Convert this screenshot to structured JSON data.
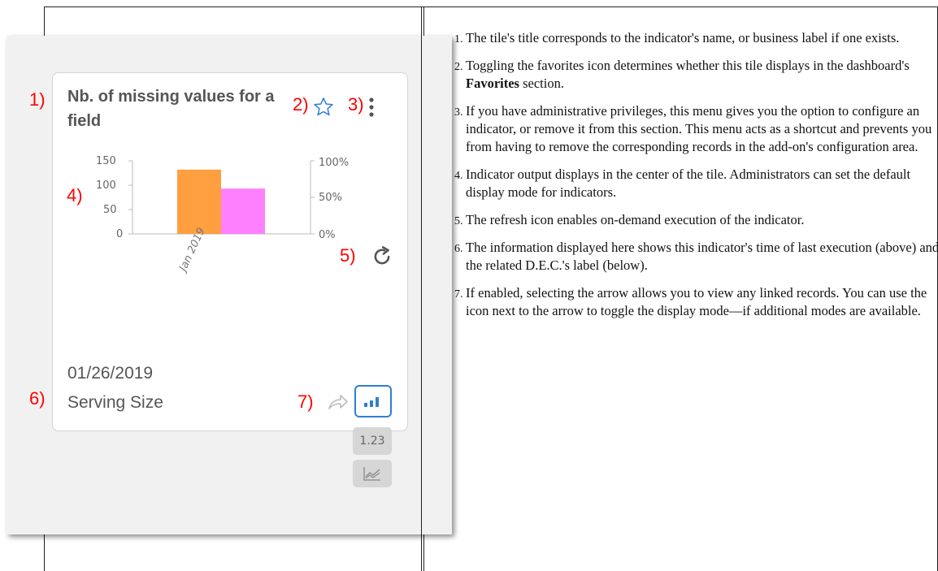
{
  "callouts": [
    "1)",
    "2)",
    "3)",
    "4)",
    "5)",
    "6)",
    "7)"
  ],
  "tile": {
    "title": "Nb. of missing values for a field",
    "date": "01/26/2019",
    "dec_label": "Serving Size",
    "table_mode_label": "1.23"
  },
  "chart_data": {
    "type": "bar",
    "categories": [
      "Jan 2019"
    ],
    "series": [
      {
        "values": [
          132
        ],
        "axis": "left",
        "color": "#ff9f40"
      },
      {
        "values": [
          0.62
        ],
        "axis": "right",
        "color": "#ff80ff"
      }
    ],
    "y_ticks": [
      "150",
      "100",
      "50",
      "0"
    ],
    "y2_ticks": [
      "100%",
      "50%",
      "0%"
    ],
    "ylim": [
      0,
      150
    ],
    "y2lim": [
      0,
      1
    ],
    "grid": false
  },
  "notes": [
    {
      "text": "The tile's title corresponds to the indicator's name, or business label if one exists."
    },
    {
      "pre": "Toggling the favorites icon determines whether this tile displays in the dashboard's ",
      "bold": "Favorites",
      "post": " section."
    },
    {
      "text": "If you have administrative privileges, this menu gives you the option to configure an indicator, or remove it from this section. This menu acts as a shortcut and prevents you from having to remove the corresponding records in the add-on's configuration area."
    },
    {
      "text": "Indicator output displays in the center of the tile. Administrators can set the default display mode for indicators."
    },
    {
      "text": "The refresh icon enables on-demand execution of the indicator."
    },
    {
      "text": "The information displayed here shows this indicator's time of last execution (above) and the related D.E.C.'s label (below)."
    },
    {
      "text": "If enabled, selecting the arrow allows you to view any linked records. You can use the icon next to the arrow to toggle the display mode—if additional modes are available."
    }
  ],
  "colors": {
    "accent": "#2f7fd1",
    "callout": "#ff0000",
    "bar1": "#ff9f40",
    "bar2": "#ff80ff"
  },
  "icons": [
    "star-icon",
    "more-vertical-icon",
    "refresh-icon",
    "share-arrow-icon",
    "bar-chart-icon",
    "line-chart-icon"
  ]
}
